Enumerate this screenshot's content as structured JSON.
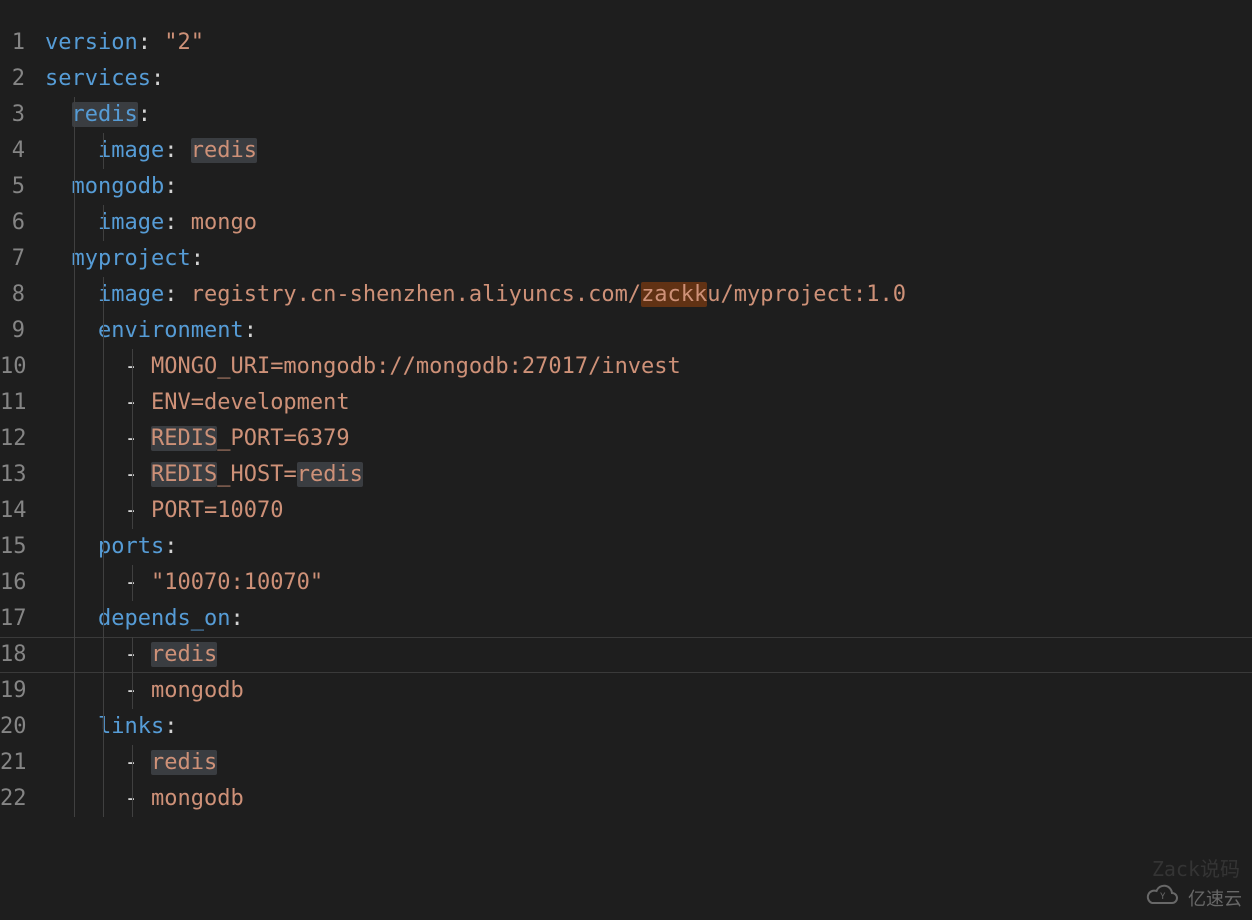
{
  "watermark": {
    "text": "亿速云",
    "faded": "Zack说码"
  },
  "lineNumbers": [
    "1",
    "2",
    "3",
    "4",
    "5",
    "6",
    "7",
    "8",
    "9",
    "10",
    "11",
    "12",
    "13",
    "14",
    "15",
    "16",
    "17",
    "18",
    "19",
    "20",
    "21",
    "22"
  ],
  "currentLine": 18,
  "code": {
    "version_key": "version",
    "version_val": "\"2\"",
    "services_key": "services",
    "redis_key": "redis",
    "image_key": "image",
    "redis_img": "redis",
    "mongodb_key": "mongodb",
    "mongo_img": "mongo",
    "myproject_key": "myproject",
    "myproject_img_pre": "registry.cn-shenzhen.aliyuncs.com/",
    "myproject_img_hl": "zackk",
    "myproject_img_post": "u/myproject:1.0",
    "environment_key": "environment",
    "env_mongo": "MONGO_URI=mongodb://mongodb:27017/invest",
    "env_env": "ENV=development",
    "env_rport_pre": "REDIS",
    "env_rport_post": "_PORT=6379",
    "env_rhost_pre": "REDIS",
    "env_rhost_mid": "_HOST=",
    "env_rhost_val": "redis",
    "env_port": "PORT=10070",
    "ports_key": "ports",
    "ports_val": "\"10070:10070\"",
    "depends_key": "depends_on",
    "dep_redis": "redis",
    "dep_mongo": "mongodb",
    "links_key": "links",
    "link_redis": "redis",
    "link_mongo": "mongodb"
  }
}
